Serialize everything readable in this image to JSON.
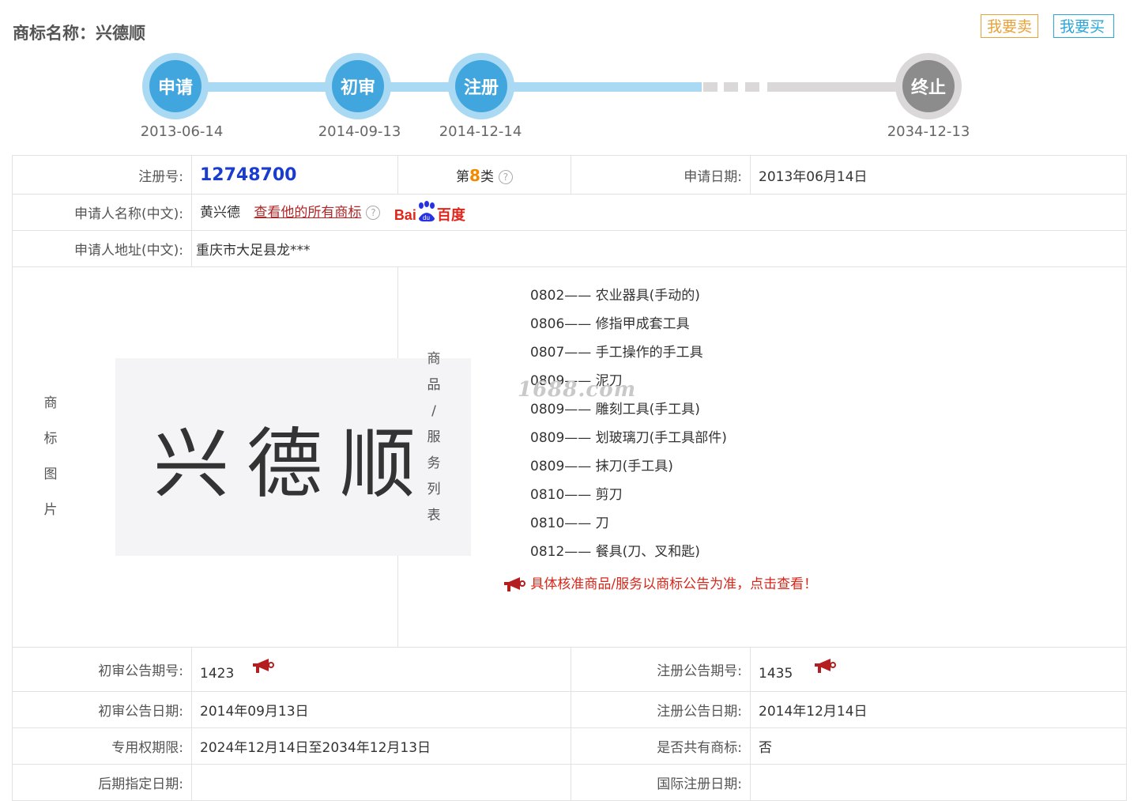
{
  "header": {
    "title": "商标名称：兴德顺",
    "sell_label": "我要卖",
    "buy_label": "我要买"
  },
  "timeline": [
    {
      "label": "申请",
      "date": "2013-06-14"
    },
    {
      "label": "初审",
      "date": "2014-09-13"
    },
    {
      "label": "注册",
      "date": "2014-12-14"
    },
    {
      "label": "终止",
      "date": "2034-12-13"
    }
  ],
  "info": {
    "reg_no_label": "注册号:",
    "reg_no": "12748700",
    "class_prefix": "第",
    "class_num": "8",
    "class_suffix": "类",
    "apply_date_label": "申请日期:",
    "apply_date": "2013年06月14日",
    "applicant_label": "申请人名称(中文):",
    "applicant": "黄兴德",
    "view_all_link": "查看他的所有商标",
    "baidu_text_a": "Bai",
    "baidu_text_b": "百度",
    "address_label": "申请人地址(中文):",
    "address": "重庆市大足县龙***",
    "image_label": [
      "商",
      "标",
      "图",
      "片"
    ],
    "trademark_text": "兴德顺",
    "goods_label": [
      "商",
      "品",
      "/",
      "服",
      "务",
      "列",
      "表"
    ],
    "goods": [
      "0802—— 农业器具(手动的)",
      "0806—— 修指甲成套工具",
      "0807—— 手工操作的手工具",
      "0809—— 泥刀",
      "0809—— 雕刻工具(手工具)",
      "0809—— 划玻璃刀(手工具部件)",
      "0809—— 抹刀(手工具)",
      "0810—— 剪刀",
      "0810—— 刀",
      "0812—— 餐具(刀、叉和匙)"
    ],
    "goods_note": "具体核准商品/服务以商标公告为准，点击查看！",
    "watermark": "1688.com",
    "prelim_no_label": "初审公告期号:",
    "prelim_no": "1423",
    "reg_pub_no_label": "注册公告期号:",
    "reg_pub_no": "1435",
    "prelim_date_label": "初审公告日期:",
    "prelim_date": "2014年09月13日",
    "reg_pub_date_label": "注册公告日期:",
    "reg_pub_date": "2014年12月14日",
    "exclusive_label": "专用权期限:",
    "exclusive": "2024年12月14日至2034年12月13日",
    "shared_label": "是否共有商标:",
    "shared": "否",
    "later_label": "后期指定日期:",
    "intl_label": "国际注册日期:"
  }
}
